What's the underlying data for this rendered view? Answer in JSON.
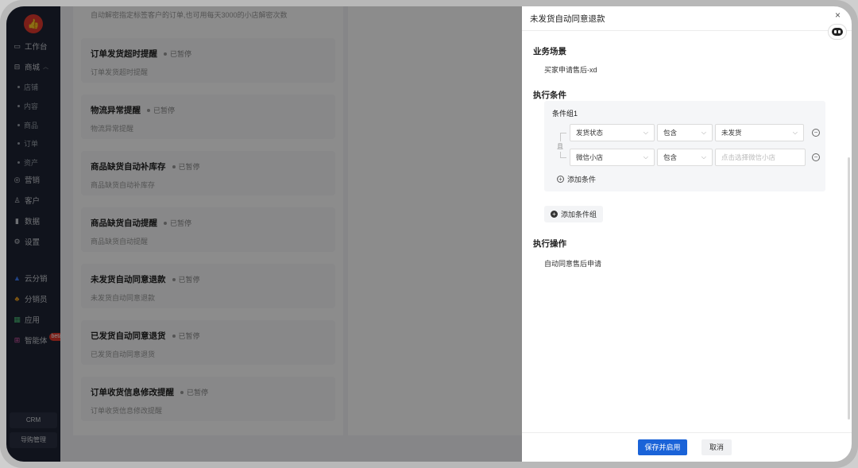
{
  "sidebar": {
    "logo_icon": "thumbs-up-icon",
    "items": [
      {
        "label": "工作台",
        "icon": "monitor-icon"
      },
      {
        "label": "商城",
        "icon": "store-icon",
        "expanded": true
      },
      {
        "label": "营销",
        "icon": "target-icon"
      },
      {
        "label": "客户",
        "icon": "user-icon"
      },
      {
        "label": "数据",
        "icon": "bar-chart-icon"
      },
      {
        "label": "设置",
        "icon": "gear-icon"
      },
      {
        "label": "云分销",
        "icon": "cloud-icon"
      },
      {
        "label": "分销员",
        "icon": "org-icon"
      },
      {
        "label": "应用",
        "icon": "apps-icon"
      },
      {
        "label": "智能体",
        "icon": "agent-icon",
        "badge": "beta"
      }
    ],
    "sub_items": [
      "店铺",
      "内容",
      "商品",
      "订单",
      "资产"
    ],
    "crm_label": "CRM",
    "guide_label": "导购管理"
  },
  "list": {
    "top_desc": "自动解密指定标签客户的订单,也可用每天3000的小店解密次数",
    "rules": [
      {
        "title": "订单发货超时提醒",
        "status": "已暂停",
        "desc": "订单发货超时提醒"
      },
      {
        "title": "物流异常提醒",
        "status": "已暂停",
        "desc": "物流异常提醒"
      },
      {
        "title": "商品缺货自动补库存",
        "status": "已暂停",
        "desc": "商品缺货自动补库存"
      },
      {
        "title": "商品缺货自动提醒",
        "status": "已暂停",
        "desc": "商品缺货自动提醒"
      },
      {
        "title": "未发货自动同意退款",
        "status": "已暂停",
        "desc": "未发货自动同意退款"
      },
      {
        "title": "已发货自动同意退货",
        "status": "已暂停",
        "desc": "已发货自动同意退货"
      },
      {
        "title": "订单收货信息修改提醒",
        "status": "已暂停",
        "desc": "订单收货信息修改提醒"
      }
    ]
  },
  "drawer": {
    "title": "未发货自动同意退款",
    "scene_title": "业务场景",
    "scene_value": "买家申请售后-xd",
    "condition_title": "执行条件",
    "group_title": "条件组1",
    "and_label": "且",
    "conditions": [
      {
        "field": "发货状态",
        "operator": "包含",
        "value": "未发货",
        "value_is_placeholder": false
      },
      {
        "field": "微信小店",
        "operator": "包含",
        "value": "点击选择微信小店",
        "value_is_placeholder": true
      }
    ],
    "add_condition_label": "添加条件",
    "add_group_label": "添加条件组",
    "action_title": "执行操作",
    "action_value": "自动同意售后申请",
    "save_label": "保存并启用",
    "cancel_label": "取消",
    "close_glyph": "×"
  },
  "colors": {
    "primary": "#1a63d8",
    "sidebar_bg": "#1e2433",
    "brand_red": "#e23a2e"
  }
}
